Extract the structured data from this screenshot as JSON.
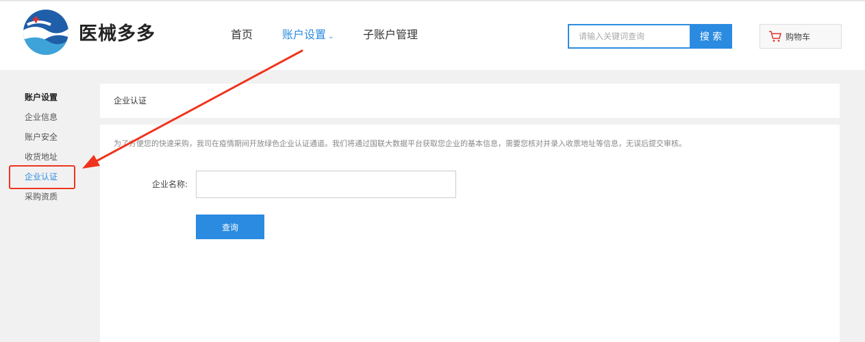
{
  "brand": {
    "name": "医械多多"
  },
  "nav": {
    "home": "首页",
    "account_settings": "账户设置",
    "sub_accounts": "子账户管理"
  },
  "search": {
    "placeholder": "请输入关键词查询",
    "button": "搜 索"
  },
  "cart": {
    "label": "购物车"
  },
  "sidebar": {
    "title": "账户设置",
    "items": [
      {
        "label": "企业信息"
      },
      {
        "label": "账户安全"
      },
      {
        "label": "收货地址"
      },
      {
        "label": "企业认证"
      },
      {
        "label": "采购资质"
      }
    ],
    "active_index": 3
  },
  "panel": {
    "title": "企业认证",
    "notice": "为了方便您的快速采购，我司在疫情期间开放绿色企业认证通道。我们将通过国联大数据平台获取您企业的基本信息，需要您核对并录入收票地址等信息，无误后提交审核。",
    "company_name_label": "企业名称:",
    "company_name_value": "",
    "query_button": "查询"
  },
  "colors": {
    "accent": "#2a8be0",
    "annotation": "#f0331e"
  }
}
